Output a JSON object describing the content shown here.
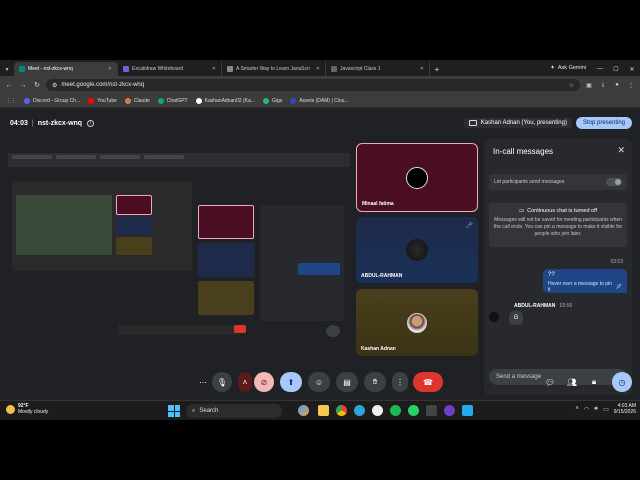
{
  "browser": {
    "tabs": [
      {
        "title": "Meet - nst-zkcx-wnq",
        "color": "#00897b",
        "active": true
      },
      {
        "title": "Excalidraw Whiteboard",
        "color": "#6965db",
        "active": false
      },
      {
        "title": "A Smarter Way to Learn JavaScri",
        "color": "#888888",
        "active": false
      },
      {
        "title": "Javascript Class 1",
        "color": "#666666",
        "active": false
      }
    ],
    "ask_gemini": "Ask Gemini",
    "url": "meet.google.com/nst-zkcx-wnq",
    "bookmarks": [
      {
        "label": "Discord - Group Ch...",
        "color": "#5865f2"
      },
      {
        "label": "YouTube",
        "color": "#ff0000"
      },
      {
        "label": "Claude",
        "color": "#d97757"
      },
      {
        "label": "ChatGPT",
        "color": "#10a37f"
      },
      {
        "label": "KashanAdnan02 (Ka...",
        "color": "#ffffff"
      },
      {
        "label": "Gigs",
        "color": "#1dbf73"
      },
      {
        "label": "Assets (DAM) | Clou...",
        "color": "#3448c5"
      }
    ]
  },
  "meet": {
    "time": "04:03",
    "separator": "|",
    "meeting_code": "nst-zkcx-wnq",
    "presenting_label": "Kashan Adnan (You, presenting)",
    "stop_presenting": "Stop presenting",
    "participants": [
      {
        "name": "Minaal fatima",
        "muted": false
      },
      {
        "name": "ABDUL-RAHMAN",
        "muted": true
      },
      {
        "name": "Kashan Adnan",
        "muted": false
      }
    ]
  },
  "panel": {
    "title": "In-call messages",
    "let_participants": "Let participants send messages",
    "notice_title": "Continuous chat is turned off",
    "notice_body": "Messages will not be saved for meeting participants when the call ends. You can pin a message to make it visible for people who join later.",
    "my_message_time": "03:53",
    "my_message": "??",
    "my_message_hint": "Hover over a message to pin it",
    "sender_name": "ABDUL-RAHMAN",
    "sender_time": "03:56",
    "their_message": "G",
    "input_placeholder": "Send a message"
  },
  "taskbar": {
    "temperature": "92°F",
    "weather": "Mostly cloudy",
    "search": "Search",
    "time": "4:03 AM",
    "date": "9/15/2026"
  },
  "colors": {
    "accent": "#a8c7fa",
    "leave": "#dc362e",
    "cam_off": "#f2b8b5"
  }
}
